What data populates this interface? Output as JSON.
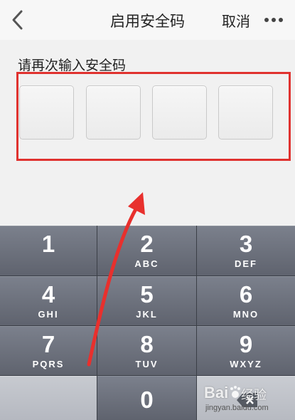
{
  "nav": {
    "title": "启用安全码",
    "cancel_label": "取消"
  },
  "pin": {
    "prompt": "请再次输入安全码",
    "length": 4,
    "entered": 0
  },
  "keypad": {
    "keys": [
      {
        "digit": "1",
        "letters": ""
      },
      {
        "digit": "2",
        "letters": "ABC"
      },
      {
        "digit": "3",
        "letters": "DEF"
      },
      {
        "digit": "4",
        "letters": "GHI"
      },
      {
        "digit": "5",
        "letters": "JKL"
      },
      {
        "digit": "6",
        "letters": "MNO"
      },
      {
        "digit": "7",
        "letters": "PQRS"
      },
      {
        "digit": "8",
        "letters": "TUV"
      },
      {
        "digit": "9",
        "letters": "WXYZ"
      },
      {
        "digit": "0",
        "letters": ""
      }
    ],
    "delete_icon": "backspace-icon"
  },
  "annotation": {
    "color": "#e0322f"
  },
  "watermark": {
    "logo": "Bai",
    "text": "经验",
    "url": "jingyan.baidu.com"
  }
}
